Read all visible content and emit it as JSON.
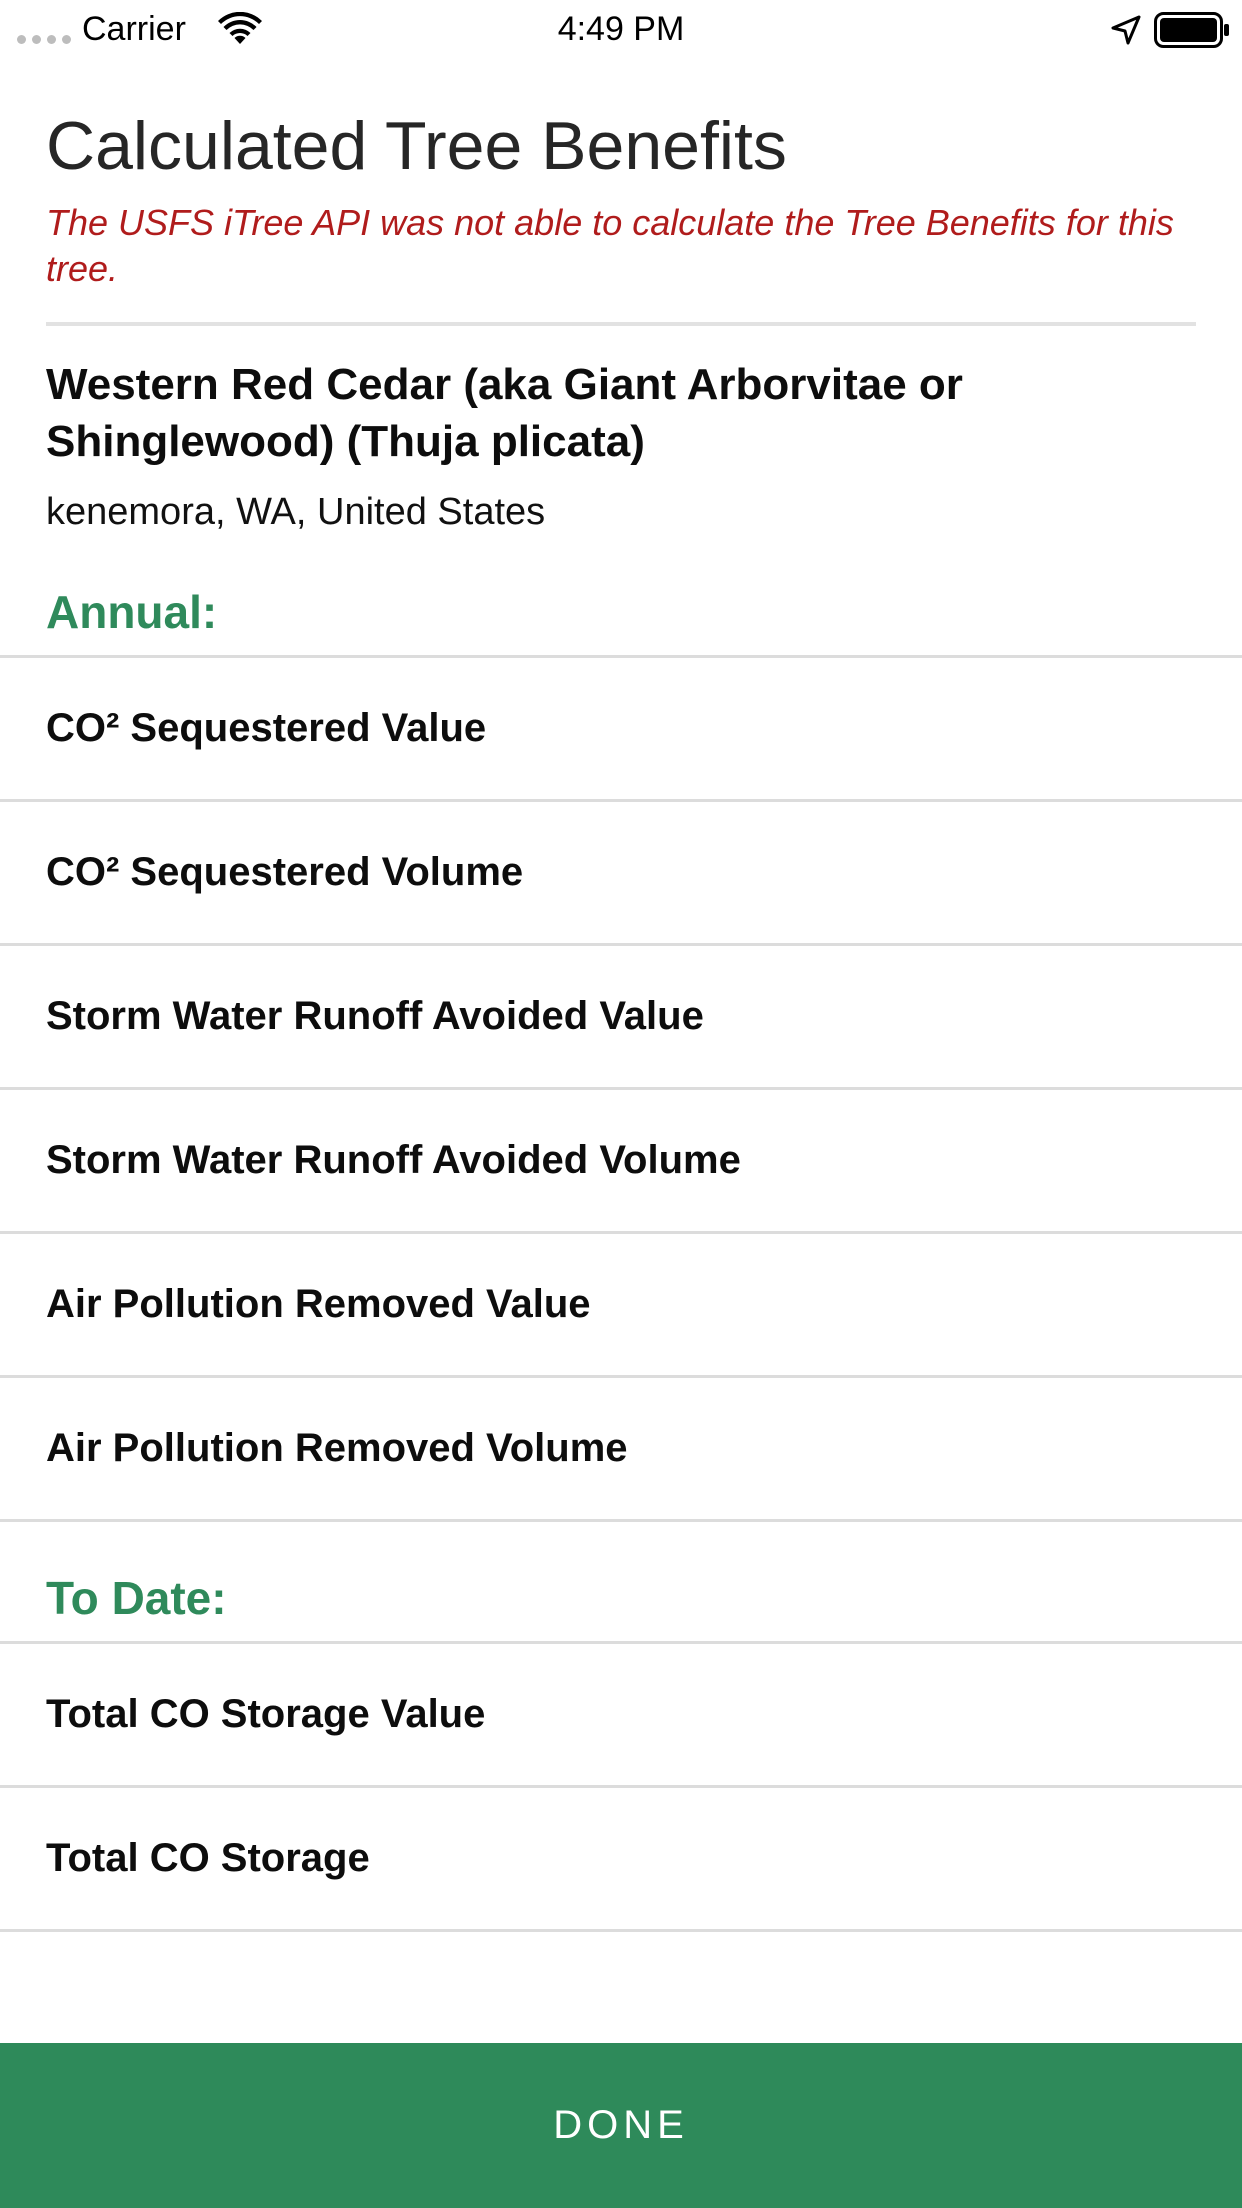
{
  "status_bar": {
    "carrier": "Carrier",
    "time": "4:49 PM"
  },
  "header": {
    "title": "Calculated Tree Benefits",
    "error_message": "The USFS iTree API was not able to calculate the Tree Benefits for this tree.",
    "tree_name": "Western Red Cedar (aka Giant Arborvitae or Shinglewood) (Thuja plicata)",
    "tree_location": "kenemora, WA, United States"
  },
  "annual": {
    "heading": "Annual:",
    "rows": [
      {
        "label": "CO² Sequestered Value"
      },
      {
        "label": "CO² Sequestered Volume"
      },
      {
        "label": "Storm Water Runoff Avoided Value"
      },
      {
        "label": "Storm Water Runoff Avoided Volume"
      },
      {
        "label": "Air Pollution Removed Value"
      },
      {
        "label": "Air Pollution Removed Volume"
      }
    ]
  },
  "to_date": {
    "heading": "To Date:",
    "rows": [
      {
        "label": "Total CO Storage Value"
      },
      {
        "label": "Total CO Storage"
      }
    ]
  },
  "footer": {
    "done_label": "DONE"
  },
  "colors": {
    "accent_green": "#2e8a5a",
    "error_red": "#b01c1c",
    "divider_gray": "#dcdcdc"
  },
  "icons": {
    "signal": "signal-dots-icon",
    "wifi": "wifi-icon",
    "location": "location-arrow-icon",
    "battery": "battery-full-icon"
  }
}
